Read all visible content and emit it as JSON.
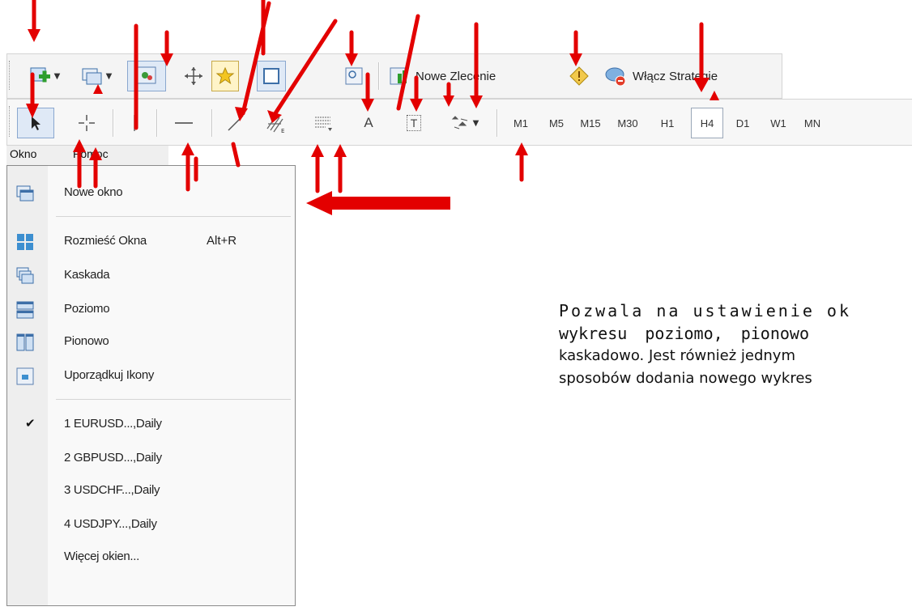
{
  "toolbar_standard": {
    "new_order_label": "Nowe Zlecenie",
    "strategies_label": "Włącz Strategie",
    "icons": [
      "new-chart-icon",
      "profiles-icon",
      "market-watch-icon",
      "navigator-icon",
      "favorites-icon",
      "data-window-icon",
      "tester-icon",
      "new-order-icon",
      "metaeditor-warning-icon",
      "strategies-icon"
    ]
  },
  "toolbar_draw": {
    "tools": [
      "cursor-icon",
      "crosshair-icon",
      "vertical-line-icon",
      "horizontal-line-icon",
      "trendline-icon",
      "channel-icon",
      "fibonacci-icon",
      "text-icon",
      "text-label-icon",
      "shapes-icon"
    ],
    "text_tool_glyph": "A",
    "label_tool_glyph": "T",
    "timeframes": [
      "M1",
      "M5",
      "M15",
      "M30",
      "H1",
      "H4",
      "D1",
      "W1",
      "MN"
    ],
    "selected_timeframe": "H4"
  },
  "menubar": {
    "window": "Okno",
    "help": "Pomoc"
  },
  "window_menu": {
    "new_window": "Nowe okno",
    "tile": "Rozmieść Okna",
    "tile_shortcut": "Alt+R",
    "cascade": "Kaskada",
    "horizontal": "Poziomo",
    "vertical": "Pionowo",
    "arrange_icons": "Uporządkuj Ikony",
    "check_mark": "✔",
    "windows": [
      "1 EURUSD...,Daily",
      "2 GBPUSD...,Daily",
      "3 USDCHF...,Daily",
      "4 USDJPY...,Daily"
    ],
    "more": "Więcej okien..."
  },
  "description": {
    "line1": "Pozwala na ustawienie ok",
    "line2": "wykresu poziomo, pionowo",
    "line3": "kaskadowo. Jest również jednym",
    "line4": "sposobów dodania nowego wykres"
  },
  "colors": {
    "arrow": "#e30000",
    "toolbar_bg": "#f4f4f4",
    "menu_bg": "#f9f9f9"
  }
}
